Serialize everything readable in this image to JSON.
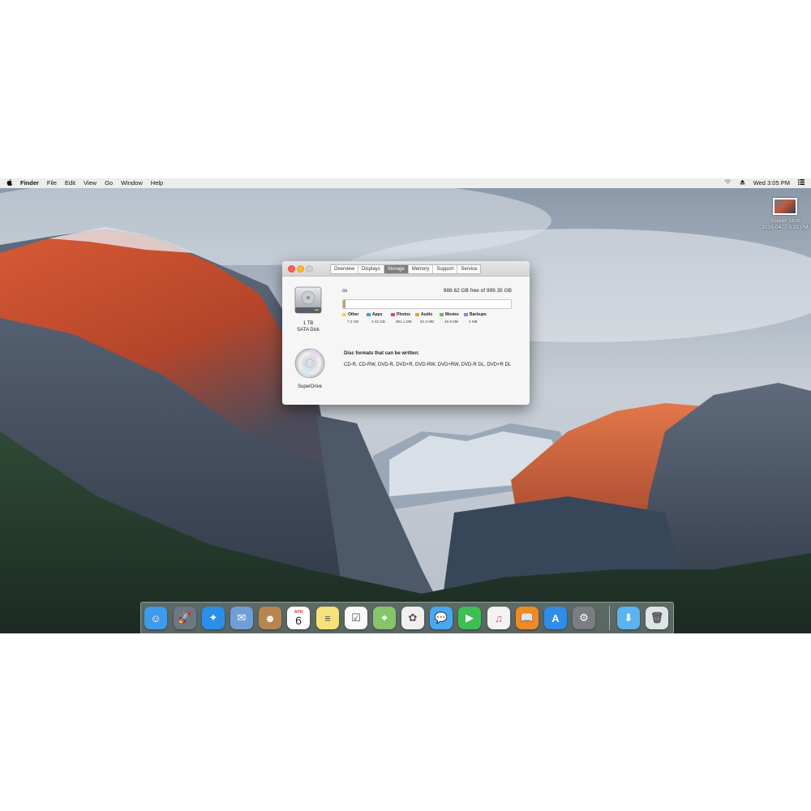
{
  "menubar": {
    "apple_icon": "apple-icon",
    "items": [
      "Finder",
      "File",
      "Edit",
      "View",
      "Go",
      "Window",
      "Help"
    ],
    "clock": "Wed 3:05 PM",
    "status_icons": [
      "wifi-icon",
      "eject-icon",
      "menu-list-icon"
    ]
  },
  "desktop": {
    "file_label_line1": "Screen Shot",
    "file_label_line2": "2016-04-... 5:20 PM"
  },
  "window": {
    "tabs": [
      "Overview",
      "Displays",
      "Storage",
      "Memory",
      "Support",
      "Service"
    ],
    "selected_tab": "Storage",
    "disk": {
      "capacity": "1 TB",
      "type": "SATA Disk",
      "volume_name": "os",
      "free_text": "988.62 GB free of 999.35 GB",
      "used_fraction": 0.0107
    },
    "categories": [
      {
        "name": "Other",
        "size": "7.3 GB",
        "color": "#f5d54a"
      },
      {
        "name": "Apps",
        "size": "2.43 GB",
        "color": "#27a9e6"
      },
      {
        "name": "Photos",
        "size": "891.1 MB",
        "color": "#e8436d"
      },
      {
        "name": "Audio",
        "size": "62.2 MB",
        "color": "#f39c1e"
      },
      {
        "name": "Movies",
        "size": "46.8 MB",
        "color": "#61c554"
      },
      {
        "name": "Backups",
        "size": "4 MB",
        "color": "#a178e0"
      }
    ],
    "optical": {
      "name": "SuperDrive",
      "formats_heading": "Disc formats that can be written:",
      "formats": "CD-R, CD-RW, DVD-R, DVD+R, DVD-RW, DVD+RW, DVD-R DL, DVD+R DL"
    }
  },
  "dock": {
    "apps": [
      {
        "name": "finder-icon",
        "color": "#3d9bea",
        "glyph": "☺"
      },
      {
        "name": "launchpad-icon",
        "color": "#6e7680",
        "glyph": "🚀"
      },
      {
        "name": "safari-icon",
        "color": "#2b8ee8",
        "glyph": "✦"
      },
      {
        "name": "mail-icon",
        "color": "#6f9fd6",
        "glyph": "✉"
      },
      {
        "name": "contacts-icon",
        "color": "#b58552",
        "glyph": "☻"
      },
      {
        "name": "calendar-icon",
        "color": "#ffffff",
        "glyph": "6"
      },
      {
        "name": "notes-icon",
        "color": "#f6e27a",
        "glyph": "≡"
      },
      {
        "name": "reminders-icon",
        "color": "#fafafa",
        "glyph": "☑"
      },
      {
        "name": "maps-icon",
        "color": "#86c46a",
        "glyph": "⌖"
      },
      {
        "name": "photos-icon",
        "color": "#f0f0f0",
        "glyph": "✿"
      },
      {
        "name": "messages-icon",
        "color": "#4aa6ef",
        "glyph": "💬"
      },
      {
        "name": "facetime-icon",
        "color": "#3ebf52",
        "glyph": "▶"
      },
      {
        "name": "itunes-icon",
        "color": "#f3f3f3",
        "glyph": "♫"
      },
      {
        "name": "ibooks-icon",
        "color": "#f08a24",
        "glyph": "📖"
      },
      {
        "name": "app-store-icon",
        "color": "#2f8ce8",
        "glyph": "A"
      },
      {
        "name": "system-preferences-icon",
        "color": "#7a7d82",
        "glyph": "⚙"
      },
      {
        "name": "downloads-icon",
        "color": "#5bb4ef",
        "glyph": "⬇"
      },
      {
        "name": "trash-icon",
        "color": "#dfe4e8",
        "glyph": "🗑"
      }
    ],
    "calendar_month": "APR",
    "calendar_day": "6"
  }
}
